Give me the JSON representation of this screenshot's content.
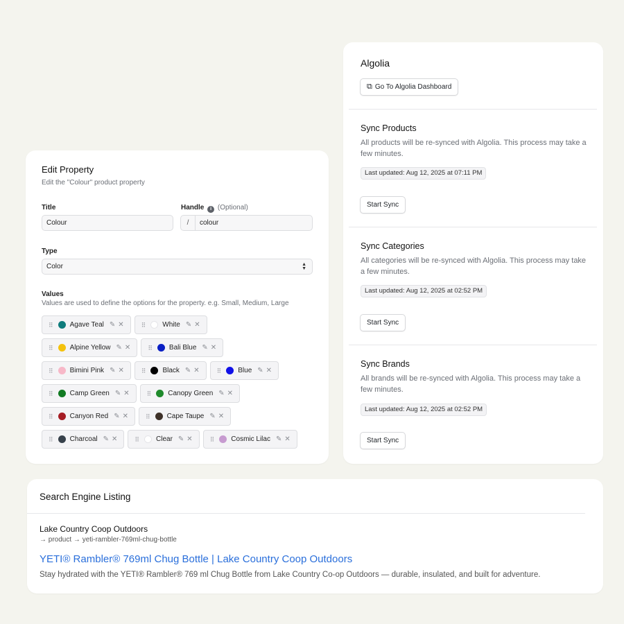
{
  "edit_property": {
    "title": "Edit Property",
    "subtitle": "Edit the \"Colour\" product property",
    "title_label": "Title",
    "title_value": "Colour",
    "handle_label": "Handle",
    "handle_optional": "(Optional)",
    "handle_prefix": "/",
    "handle_value": "colour",
    "type_label": "Type",
    "type_value": "Color",
    "values_label": "Values",
    "values_help": "Values are used to define the options for the property. e.g. Small, Medium, Large",
    "values": [
      [
        {
          "label": "Agave Teal",
          "color": "#0f7c7c"
        },
        {
          "label": "White",
          "color": "#ffffff"
        }
      ],
      [
        {
          "label": "Alpine Yellow",
          "color": "#f4c20d"
        },
        {
          "label": "Bali Blue",
          "color": "#0a1fc4"
        }
      ],
      [
        {
          "label": "Bimini Pink",
          "color": "#f7b8c8"
        },
        {
          "label": "Black",
          "color": "#000000"
        },
        {
          "label": "Blue",
          "color": "#1010e8"
        }
      ],
      [
        {
          "label": "Camp Green",
          "color": "#117a22"
        },
        {
          "label": "Canopy Green",
          "color": "#1f8a2c"
        }
      ],
      [
        {
          "label": "Canyon Red",
          "color": "#a51d24"
        },
        {
          "label": "Cape Taupe",
          "color": "#3e3129"
        }
      ],
      [
        {
          "label": "Charcoal",
          "color": "#37414b"
        },
        {
          "label": "Clear",
          "color": "#ffffff"
        },
        {
          "label": "Cosmic Lilac",
          "color": "#c79bd0"
        }
      ]
    ]
  },
  "algolia": {
    "title": "Algolia",
    "dashboard_button": "Go To Algolia Dashboard",
    "sections": [
      {
        "title": "Sync Products",
        "desc": "All products will be re-synced with Algolia. This process may take a few minutes.",
        "updated": "Last updated: Aug 12, 2025 at 07:11 PM",
        "button": "Start Sync"
      },
      {
        "title": "Sync Categories",
        "desc": "All categories will be re-synced with Algolia. This process may take a few minutes.",
        "updated": "Last updated: Aug 12, 2025 at 02:52 PM",
        "button": "Start Sync"
      },
      {
        "title": "Sync Brands",
        "desc": "All brands will be re-synced with Algolia. This process may take a few minutes.",
        "updated": "Last updated: Aug 12, 2025 at 02:52 PM",
        "button": "Start Sync"
      }
    ]
  },
  "seo": {
    "title": "Search Engine Listing",
    "store": "Lake Country Coop Outdoors",
    "path": "→ product → yeti-rambler-769ml-chug-bottle",
    "link": "YETI® Rambler® 769ml Chug Bottle | Lake Country Coop Outdoors",
    "description": "Stay hydrated with the YETI® Rambler® 769 ml Chug Bottle from Lake Country Co-op Outdoors — durable, insulated, and built for adventure."
  }
}
